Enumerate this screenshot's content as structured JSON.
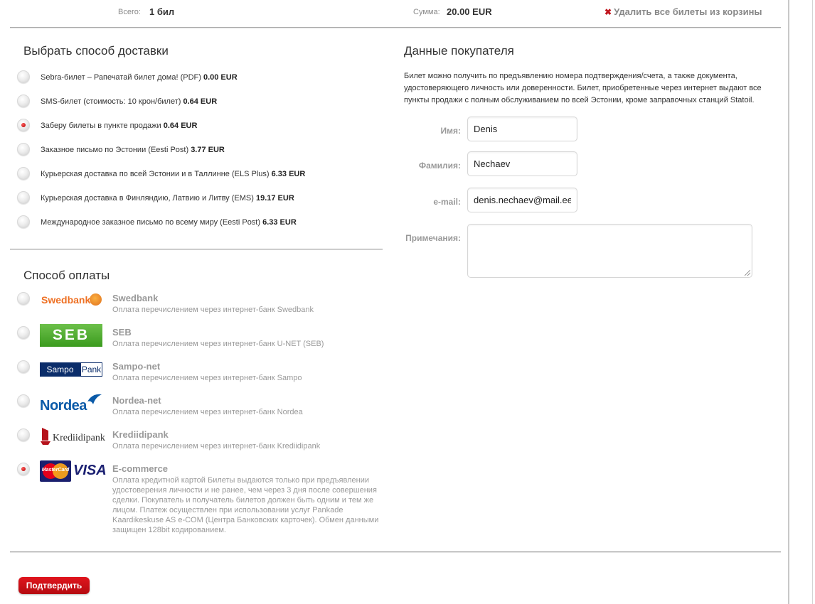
{
  "summary": {
    "total_label": "Всего:",
    "total_value": "1 бил",
    "sum_label": "Сумма:",
    "sum_value": "20.00 EUR",
    "clear_icon": "✖",
    "clear_label": "Удалить все билеты из корзины"
  },
  "delivery": {
    "title": "Выбрать способ доставки",
    "options": [
      {
        "label": "Sebra-билет – Рапечатай билет дома! (PDF)",
        "price": "0.00 EUR",
        "checked": false
      },
      {
        "label": "SMS-билет (стоимость: 10 крон/билет)",
        "price": "0.64 EUR",
        "checked": false
      },
      {
        "label": "Заберу билеты в пункте продажи",
        "price": "0.64 EUR",
        "checked": true
      },
      {
        "label": "Заказное письмо по Эстонии (Eesti Post)",
        "price": "3.77 EUR",
        "checked": false
      },
      {
        "label": "Курьерская доставка по всей Эстонии и в Таллинне (ELS Plus)",
        "price": "6.33 EUR",
        "checked": false
      },
      {
        "label": "Курьерская доставка в Финляндию, Латвию и Литву (EMS)",
        "price": "19.17 EUR",
        "checked": false
      },
      {
        "label": "Международное заказное письмо по всему миру (Eesti Post)",
        "price": "6.33 EUR",
        "checked": false
      }
    ]
  },
  "payment": {
    "title": "Способ оплаты",
    "methods": [
      {
        "name": "Swedbank",
        "desc": "Оплата перечислением через интернет-банк Swedbank",
        "logo_text": "Swedbank",
        "checked": false
      },
      {
        "name": "SEB",
        "desc": "Оплата перечислением через интернет-банк U-NET (SEB)",
        "logo_text": "SEB",
        "checked": false
      },
      {
        "name": "Sampo-net",
        "desc": "Оплата перечислением через интернет-банк Sampo",
        "logo_text": "Sampo",
        "logo_text2": "Pank",
        "checked": false
      },
      {
        "name": "Nordea-net",
        "desc": "Оплата перечислением через интернет-банк Nordea",
        "logo_text": "Nordea",
        "checked": false
      },
      {
        "name": "Krediidipank",
        "desc": "Оплата перечислением через интернет-банк Krediidipank",
        "logo_text": "Krediidipank",
        "checked": false
      },
      {
        "name": "E-commerce",
        "desc": "Оплата кредитной картой Билеты выдаются только при предъявлении удостоверения личности и не ранее, чем через 3 дня после совершения сделки. Покупатель и получатель билетов должен быть одним и тем же лицом. Платеж осуществлен при использовании услуг Pankade Kaardikeskuse AS e-COM (Центра Банковских карточек). Обмен данными защищен 128bit кодированием.",
        "logo_text": "MasterCard",
        "logo_text2": "VISA",
        "checked": true
      }
    ]
  },
  "buyer": {
    "title": "Данные покупателя",
    "info": "Билет можно получить по предъявлению номера подтверждения/счета, а также документа, удостоверяющего личность или доверенности. Билет, приобретенные через интернет выдают все пункты продажи с полным обслуживанием по всей Эстонии, кроме заправочных станций Statoil.",
    "first_name_label": "Имя:",
    "first_name": "Denis",
    "last_name_label": "Фамилия:",
    "last_name": "Nechaev",
    "email_label": "e-mail:",
    "email": "denis.nechaev@mail.ee",
    "notes_label": "Примечания:",
    "notes": ""
  },
  "confirm_label": "Подтвердить",
  "colors": {
    "accent": "#c0141c",
    "button": "#d0121a",
    "muted": "#999999"
  }
}
